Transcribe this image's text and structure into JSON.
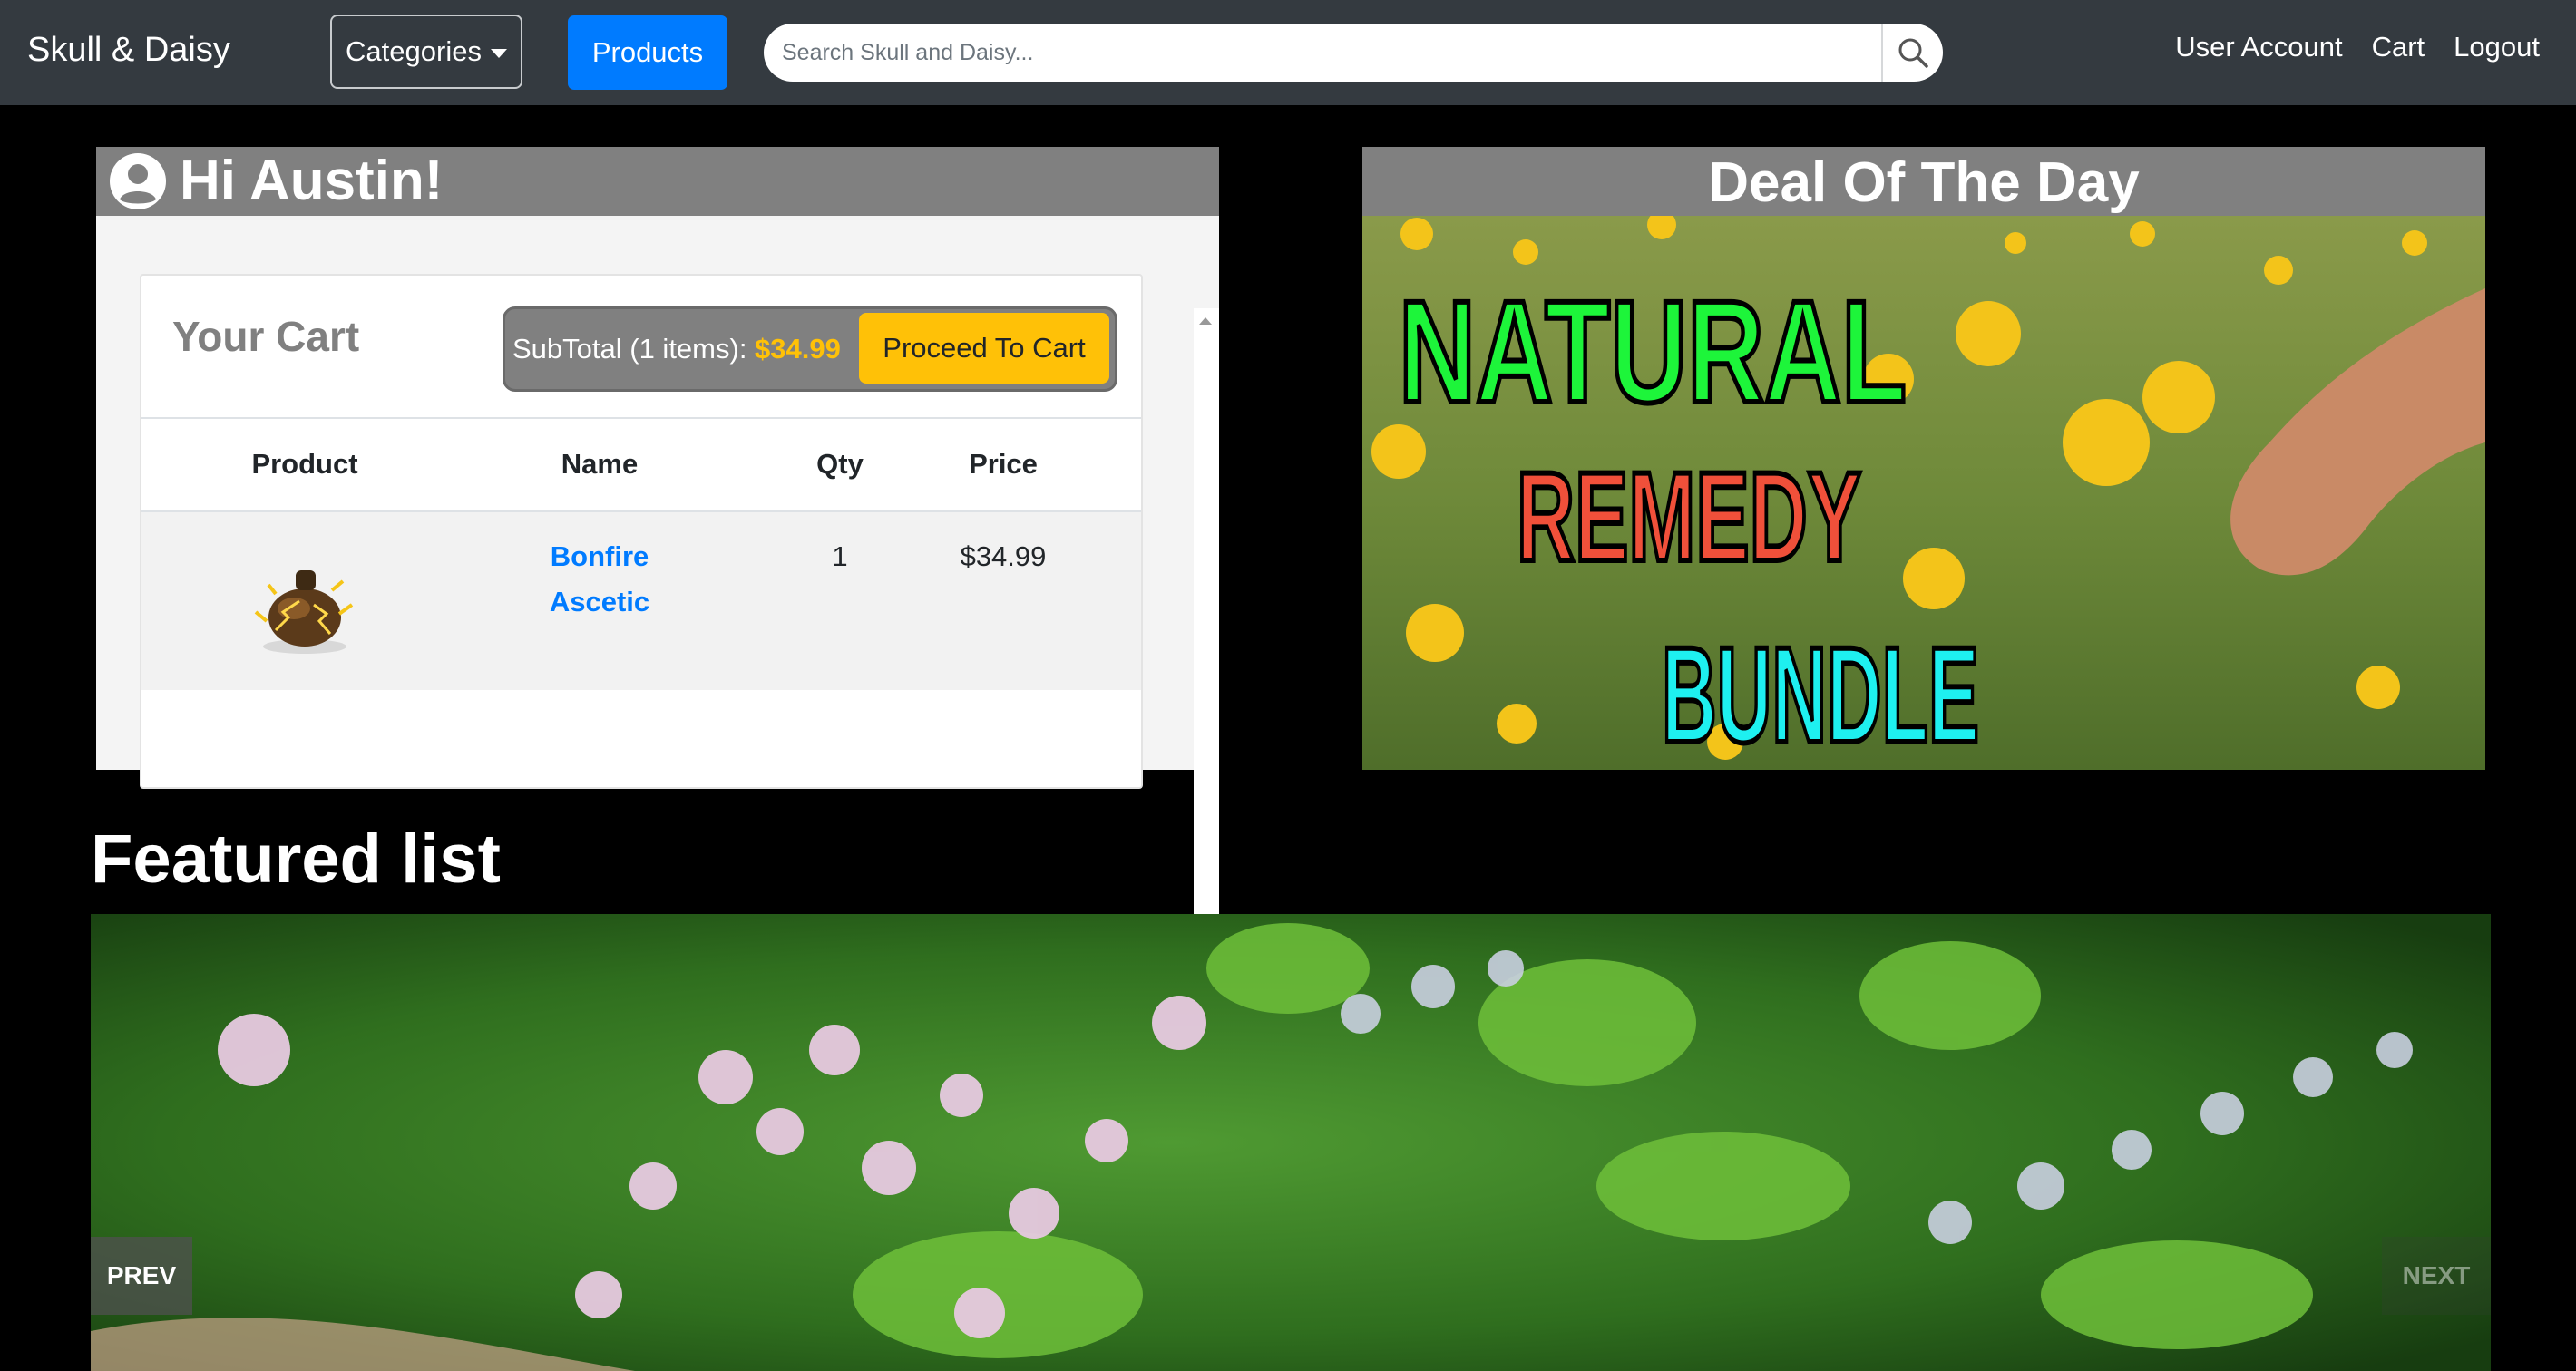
{
  "navbar": {
    "brand": "Skull & Daisy",
    "categories_label": "Categories",
    "products_label": "Products",
    "search_placeholder": "Search Skull and Daisy...",
    "links": [
      "User Account",
      "Cart",
      "Logout"
    ]
  },
  "welcome": {
    "greeting": "Hi Austin!",
    "cart_title": "Your Cart",
    "subtotal_label": "SubTotal (1 items): ",
    "subtotal_amount": "$34.99",
    "proceed_label": "Proceed To Cart",
    "columns": [
      "Product",
      "Name",
      "Qty",
      "Price"
    ],
    "items": [
      {
        "name": "Bonfire Ascetic",
        "qty": "1",
        "price": "$34.99",
        "image_icon": "bonfire-ascetic-thumbnail"
      }
    ]
  },
  "deal": {
    "title": "Deal Of The Day",
    "banner_lines": [
      "NATURAL",
      "REMEDY",
      "BUNDLE"
    ]
  },
  "featured": {
    "title": "Featured list",
    "prev_label": "PREV",
    "next_label": "NEXT"
  },
  "colors": {
    "navbar_bg": "#343a40",
    "primary": "#007bff",
    "warning": "#ffc107",
    "panel_header": "#808080"
  }
}
